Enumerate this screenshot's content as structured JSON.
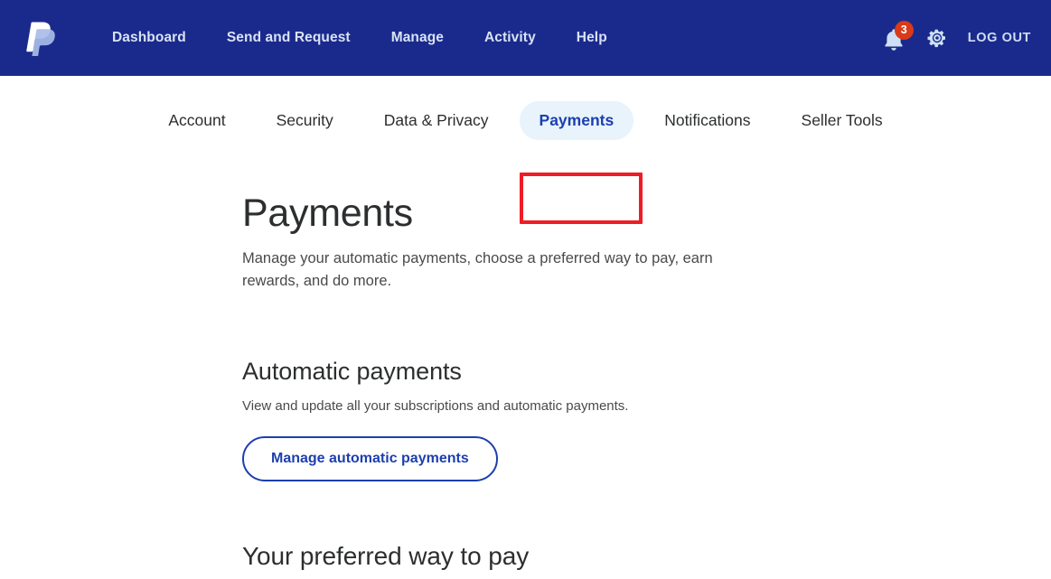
{
  "header": {
    "logo_icon": "paypal-logo-icon",
    "nav": [
      {
        "label": "Dashboard"
      },
      {
        "label": "Send and Request"
      },
      {
        "label": "Manage"
      },
      {
        "label": "Activity"
      },
      {
        "label": "Help"
      }
    ],
    "notifications": {
      "icon": "bell-icon",
      "badge_count": "3"
    },
    "settings_icon": "gear-icon",
    "logout_label": "LOG OUT",
    "background_color": "#1a2a8c"
  },
  "tabs": {
    "items": [
      {
        "label": "Account",
        "active": false
      },
      {
        "label": "Security",
        "active": false
      },
      {
        "label": "Data & Privacy",
        "active": false
      },
      {
        "label": "Payments",
        "active": true
      },
      {
        "label": "Notifications",
        "active": false
      },
      {
        "label": "Seller Tools",
        "active": false
      }
    ],
    "active_tab": "Payments",
    "active_pill_color": "#e8f3fc",
    "active_text_color": "#1d3faf",
    "highlight_box_color": "#ee1c25"
  },
  "main": {
    "title": "Payments",
    "subtitle": "Manage your automatic payments, choose a preferred way to pay, earn rewards, and do more.",
    "sections": [
      {
        "title": "Automatic payments",
        "description": "View and update all your subscriptions and automatic payments.",
        "button_label": "Manage automatic payments"
      },
      {
        "title": "Your preferred way to pay"
      }
    ]
  }
}
